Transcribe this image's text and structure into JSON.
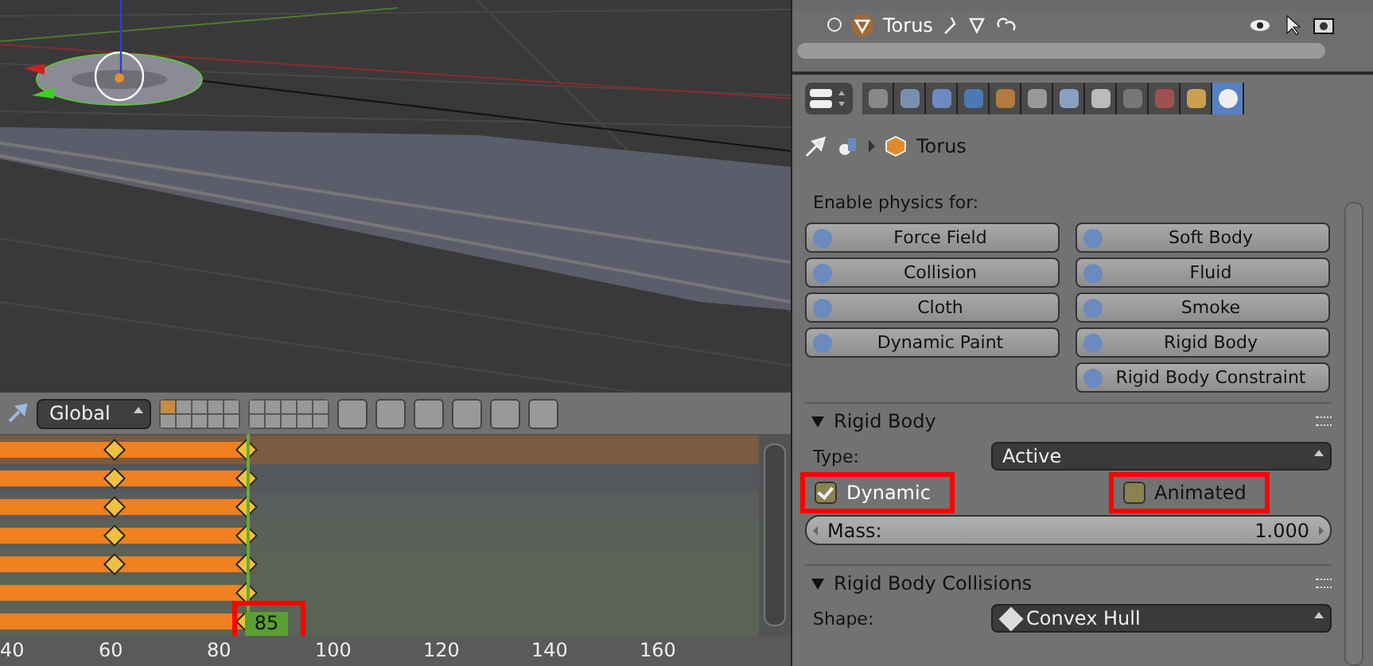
{
  "timeline_header": {
    "orientation": "Global"
  },
  "timeline": {
    "channels": [
      {
        "color": "#7a5a40",
        "early_key": true
      },
      {
        "color": "#54575c",
        "early_key": true
      },
      {
        "color": "#5a5d5e",
        "early_key": true
      },
      {
        "color": "#5a6158",
        "early_key": true
      },
      {
        "color": "#5a6356",
        "early_key": true
      },
      {
        "color": "#5a6356",
        "early_key": false
      },
      {
        "color": "#5a6356",
        "early_key": false
      }
    ],
    "current_frame": "85",
    "current_frame_highlighted": true,
    "ruler": [
      "40",
      "60",
      "80",
      "100",
      "120",
      "140",
      "160"
    ]
  },
  "outliner": {
    "rows": [
      {
        "name": "Torus"
      }
    ]
  },
  "properties": {
    "tabs": [
      {
        "selected": false
      },
      {
        "selected": false
      },
      {
        "selected": false
      },
      {
        "selected": false
      },
      {
        "selected": false
      },
      {
        "selected": false
      },
      {
        "selected": false
      },
      {
        "selected": false
      },
      {
        "selected": false
      },
      {
        "selected": false
      },
      {
        "selected": false
      },
      {
        "selected": true
      }
    ],
    "breadcrumb": "Torus",
    "enable_label": "Enable physics for:",
    "physics_left": [
      "Force Field",
      "Collision",
      "Cloth",
      "Dynamic Paint"
    ],
    "physics_right": [
      "Soft Body",
      "Fluid",
      "Smoke",
      "Rigid Body",
      "Rigid Body Constraint"
    ],
    "rigid_body": {
      "title": "Rigid Body",
      "expanded": true,
      "type_label": "Type:",
      "type_value": "Active",
      "checkboxes": [
        {
          "label": "Dynamic",
          "checked": true,
          "highlighted": true
        },
        {
          "label": "Animated",
          "checked": false,
          "highlighted": true
        }
      ],
      "mass_label": "Mass:",
      "mass_value": "1.000"
    },
    "collisions": {
      "title": "Rigid Body Collisions",
      "expanded": true,
      "shape_label": "Shape:",
      "shape_value": "Convex Hull"
    }
  }
}
